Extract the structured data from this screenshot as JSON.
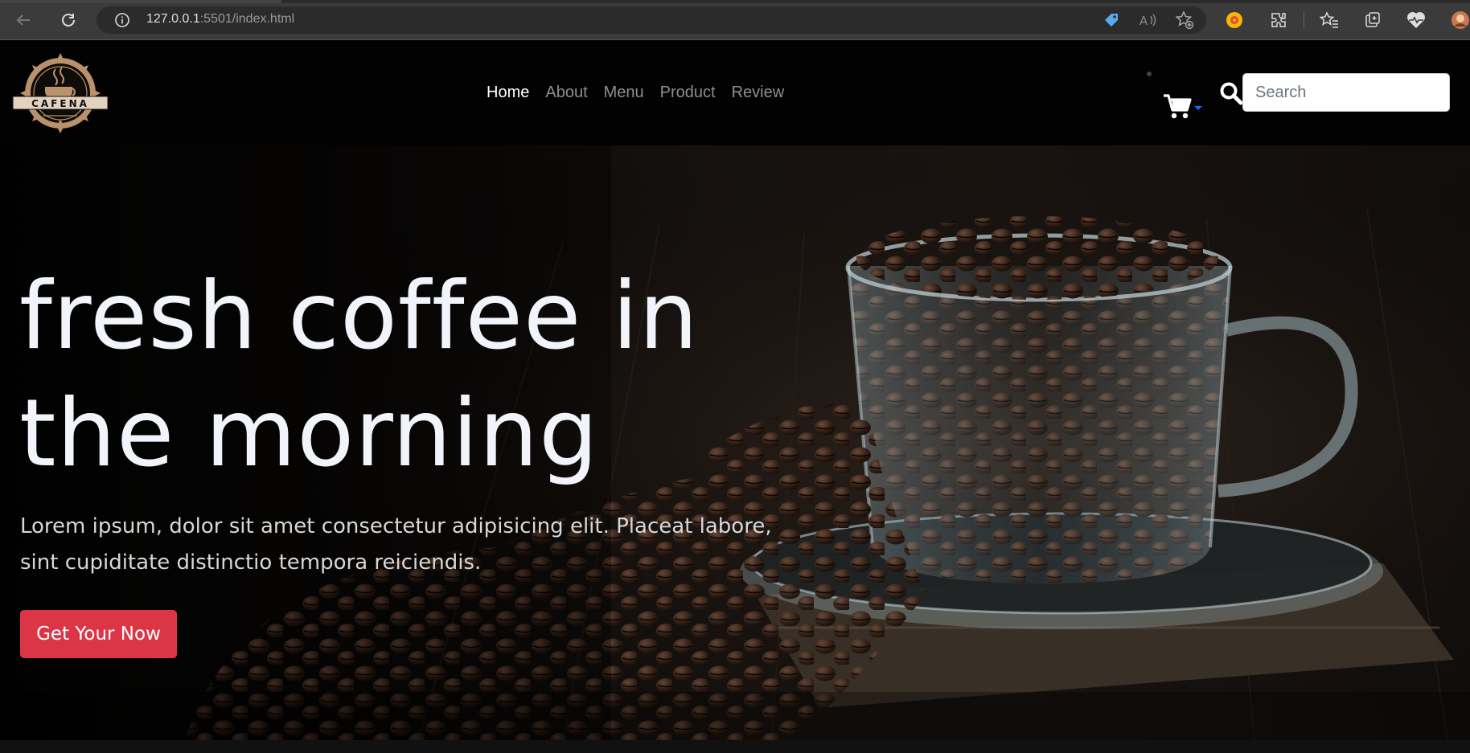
{
  "browser": {
    "url_host": "127.0.0.1",
    "url_rest": ":5501/index.html",
    "icons": [
      "back-icon",
      "reload-icon",
      "info-icon",
      "tag-icon",
      "read-aloud-icon",
      "add-favorite-icon",
      "extension-color-icon",
      "extensions-icon",
      "favorites-icon",
      "collections-icon",
      "health-icon",
      "profile-avatar"
    ]
  },
  "navbar": {
    "logo_text": "CAFENA",
    "links": [
      {
        "label": "Home",
        "active": true
      },
      {
        "label": "About",
        "active": false
      },
      {
        "label": "Menu",
        "active": false
      },
      {
        "label": "Product",
        "active": false
      },
      {
        "label": "Review",
        "active": false
      }
    ],
    "search_placeholder": "Search"
  },
  "hero": {
    "title_line1": "fresh coffee in",
    "title_line2": "the morning",
    "text_line1": "Lorem ipsum, dolor sit amet consectetur adipisicing elit. Placeat labore,",
    "text_line2": "sint cupiditate distinctio tempora reiciendis.",
    "cta_label": "Get Your Now",
    "image_alt": "glass cup full of roasted coffee beans on saucer"
  },
  "colors": {
    "accent_red": "#dc3545",
    "cart_caret": "#0d6efd",
    "logo_gold": "#b9916a"
  }
}
